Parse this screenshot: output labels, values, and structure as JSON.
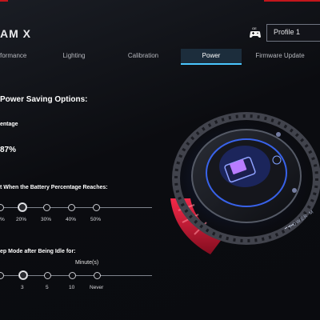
{
  "app": {
    "title": "AM X"
  },
  "profile": {
    "selected": "Profile 1"
  },
  "tabs": [
    {
      "label": "formance"
    },
    {
      "label": "Lighting"
    },
    {
      "label": "Calibration"
    },
    {
      "label": "Power",
      "active": true
    },
    {
      "label": "Firmware Update"
    }
  ],
  "power": {
    "section_title": "Power Saving Options:",
    "battery_label": "entage",
    "battery_value": "87%",
    "limit_label": "t When the Battery Percentage Reaches:",
    "limit_options": [
      "%",
      "20%",
      "30%",
      "40%",
      "50%"
    ],
    "limit_selected_index": 1,
    "sleep_label": "ep Mode after Being Idle for:",
    "sleep_unit": "Minute(s)",
    "sleep_options": [
      "",
      "3",
      "5",
      "10",
      "Never"
    ],
    "sleep_selected_index": 1
  },
  "hero": {
    "device_text": "POWER M"
  },
  "colors": {
    "accent": "#4ac6ff",
    "brand_red": "#c3161c",
    "glow_red": "#ff2040"
  }
}
